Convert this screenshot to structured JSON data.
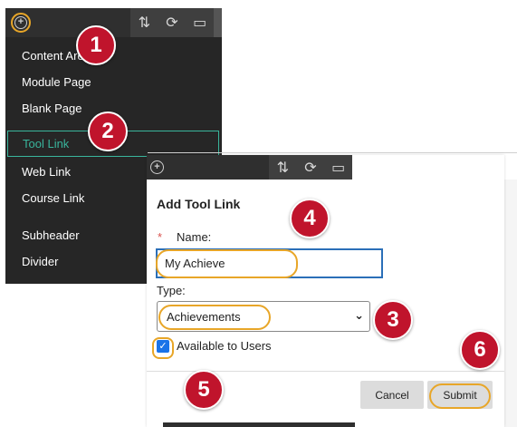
{
  "menu": {
    "items": [
      {
        "label": "Content Area"
      },
      {
        "label": "Module Page"
      },
      {
        "label": "Blank Page"
      },
      {
        "label": "Tool Link"
      },
      {
        "label": "Web Link"
      },
      {
        "label": "Course Link"
      },
      {
        "label": "Subheader"
      },
      {
        "label": "Divider"
      }
    ],
    "selected": "Tool Link",
    "toolbar_icons": [
      "add-circle-icon",
      "reorder-icon",
      "refresh-icon",
      "folder-icon"
    ]
  },
  "dialog": {
    "title": "Add Tool Link",
    "name": {
      "required_marker": "*",
      "label": "Name:",
      "value": "My Achieve"
    },
    "type": {
      "label": "Type:",
      "value": "Achievements"
    },
    "available": {
      "label": "Available to Users",
      "checked": true
    },
    "cancel_label": "Cancel",
    "submit_label": "Submit"
  },
  "steps": [
    "1",
    "2",
    "3",
    "4",
    "5",
    "6"
  ],
  "colors": {
    "highlight": "#e8a628",
    "badge": "#c0142c",
    "selected_item": "#39b59c",
    "menu_bg": "#262626"
  }
}
